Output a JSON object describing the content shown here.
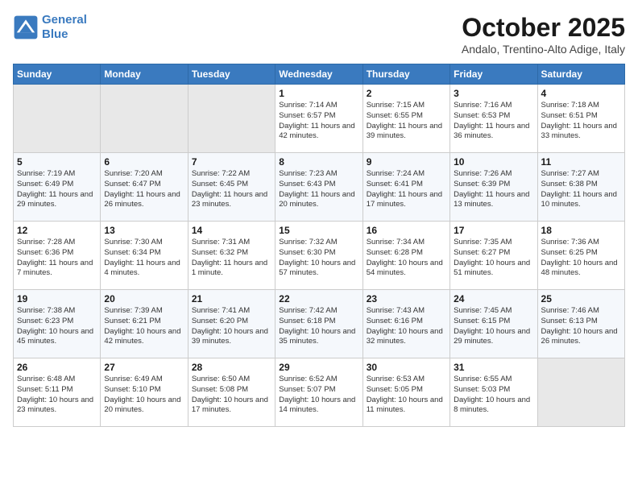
{
  "header": {
    "logo_line1": "General",
    "logo_line2": "Blue",
    "month": "October 2025",
    "location": "Andalo, Trentino-Alto Adige, Italy"
  },
  "weekdays": [
    "Sunday",
    "Monday",
    "Tuesday",
    "Wednesday",
    "Thursday",
    "Friday",
    "Saturday"
  ],
  "weeks": [
    [
      {
        "day": "",
        "info": ""
      },
      {
        "day": "",
        "info": ""
      },
      {
        "day": "",
        "info": ""
      },
      {
        "day": "1",
        "info": "Sunrise: 7:14 AM\nSunset: 6:57 PM\nDaylight: 11 hours and 42 minutes."
      },
      {
        "day": "2",
        "info": "Sunrise: 7:15 AM\nSunset: 6:55 PM\nDaylight: 11 hours and 39 minutes."
      },
      {
        "day": "3",
        "info": "Sunrise: 7:16 AM\nSunset: 6:53 PM\nDaylight: 11 hours and 36 minutes."
      },
      {
        "day": "4",
        "info": "Sunrise: 7:18 AM\nSunset: 6:51 PM\nDaylight: 11 hours and 33 minutes."
      }
    ],
    [
      {
        "day": "5",
        "info": "Sunrise: 7:19 AM\nSunset: 6:49 PM\nDaylight: 11 hours and 29 minutes."
      },
      {
        "day": "6",
        "info": "Sunrise: 7:20 AM\nSunset: 6:47 PM\nDaylight: 11 hours and 26 minutes."
      },
      {
        "day": "7",
        "info": "Sunrise: 7:22 AM\nSunset: 6:45 PM\nDaylight: 11 hours and 23 minutes."
      },
      {
        "day": "8",
        "info": "Sunrise: 7:23 AM\nSunset: 6:43 PM\nDaylight: 11 hours and 20 minutes."
      },
      {
        "day": "9",
        "info": "Sunrise: 7:24 AM\nSunset: 6:41 PM\nDaylight: 11 hours and 17 minutes."
      },
      {
        "day": "10",
        "info": "Sunrise: 7:26 AM\nSunset: 6:39 PM\nDaylight: 11 hours and 13 minutes."
      },
      {
        "day": "11",
        "info": "Sunrise: 7:27 AM\nSunset: 6:38 PM\nDaylight: 11 hours and 10 minutes."
      }
    ],
    [
      {
        "day": "12",
        "info": "Sunrise: 7:28 AM\nSunset: 6:36 PM\nDaylight: 11 hours and 7 minutes."
      },
      {
        "day": "13",
        "info": "Sunrise: 7:30 AM\nSunset: 6:34 PM\nDaylight: 11 hours and 4 minutes."
      },
      {
        "day": "14",
        "info": "Sunrise: 7:31 AM\nSunset: 6:32 PM\nDaylight: 11 hours and 1 minute."
      },
      {
        "day": "15",
        "info": "Sunrise: 7:32 AM\nSunset: 6:30 PM\nDaylight: 10 hours and 57 minutes."
      },
      {
        "day": "16",
        "info": "Sunrise: 7:34 AM\nSunset: 6:28 PM\nDaylight: 10 hours and 54 minutes."
      },
      {
        "day": "17",
        "info": "Sunrise: 7:35 AM\nSunset: 6:27 PM\nDaylight: 10 hours and 51 minutes."
      },
      {
        "day": "18",
        "info": "Sunrise: 7:36 AM\nSunset: 6:25 PM\nDaylight: 10 hours and 48 minutes."
      }
    ],
    [
      {
        "day": "19",
        "info": "Sunrise: 7:38 AM\nSunset: 6:23 PM\nDaylight: 10 hours and 45 minutes."
      },
      {
        "day": "20",
        "info": "Sunrise: 7:39 AM\nSunset: 6:21 PM\nDaylight: 10 hours and 42 minutes."
      },
      {
        "day": "21",
        "info": "Sunrise: 7:41 AM\nSunset: 6:20 PM\nDaylight: 10 hours and 39 minutes."
      },
      {
        "day": "22",
        "info": "Sunrise: 7:42 AM\nSunset: 6:18 PM\nDaylight: 10 hours and 35 minutes."
      },
      {
        "day": "23",
        "info": "Sunrise: 7:43 AM\nSunset: 6:16 PM\nDaylight: 10 hours and 32 minutes."
      },
      {
        "day": "24",
        "info": "Sunrise: 7:45 AM\nSunset: 6:15 PM\nDaylight: 10 hours and 29 minutes."
      },
      {
        "day": "25",
        "info": "Sunrise: 7:46 AM\nSunset: 6:13 PM\nDaylight: 10 hours and 26 minutes."
      }
    ],
    [
      {
        "day": "26",
        "info": "Sunrise: 6:48 AM\nSunset: 5:11 PM\nDaylight: 10 hours and 23 minutes."
      },
      {
        "day": "27",
        "info": "Sunrise: 6:49 AM\nSunset: 5:10 PM\nDaylight: 10 hours and 20 minutes."
      },
      {
        "day": "28",
        "info": "Sunrise: 6:50 AM\nSunset: 5:08 PM\nDaylight: 10 hours and 17 minutes."
      },
      {
        "day": "29",
        "info": "Sunrise: 6:52 AM\nSunset: 5:07 PM\nDaylight: 10 hours and 14 minutes."
      },
      {
        "day": "30",
        "info": "Sunrise: 6:53 AM\nSunset: 5:05 PM\nDaylight: 10 hours and 11 minutes."
      },
      {
        "day": "31",
        "info": "Sunrise: 6:55 AM\nSunset: 5:03 PM\nDaylight: 10 hours and 8 minutes."
      },
      {
        "day": "",
        "info": ""
      }
    ]
  ]
}
